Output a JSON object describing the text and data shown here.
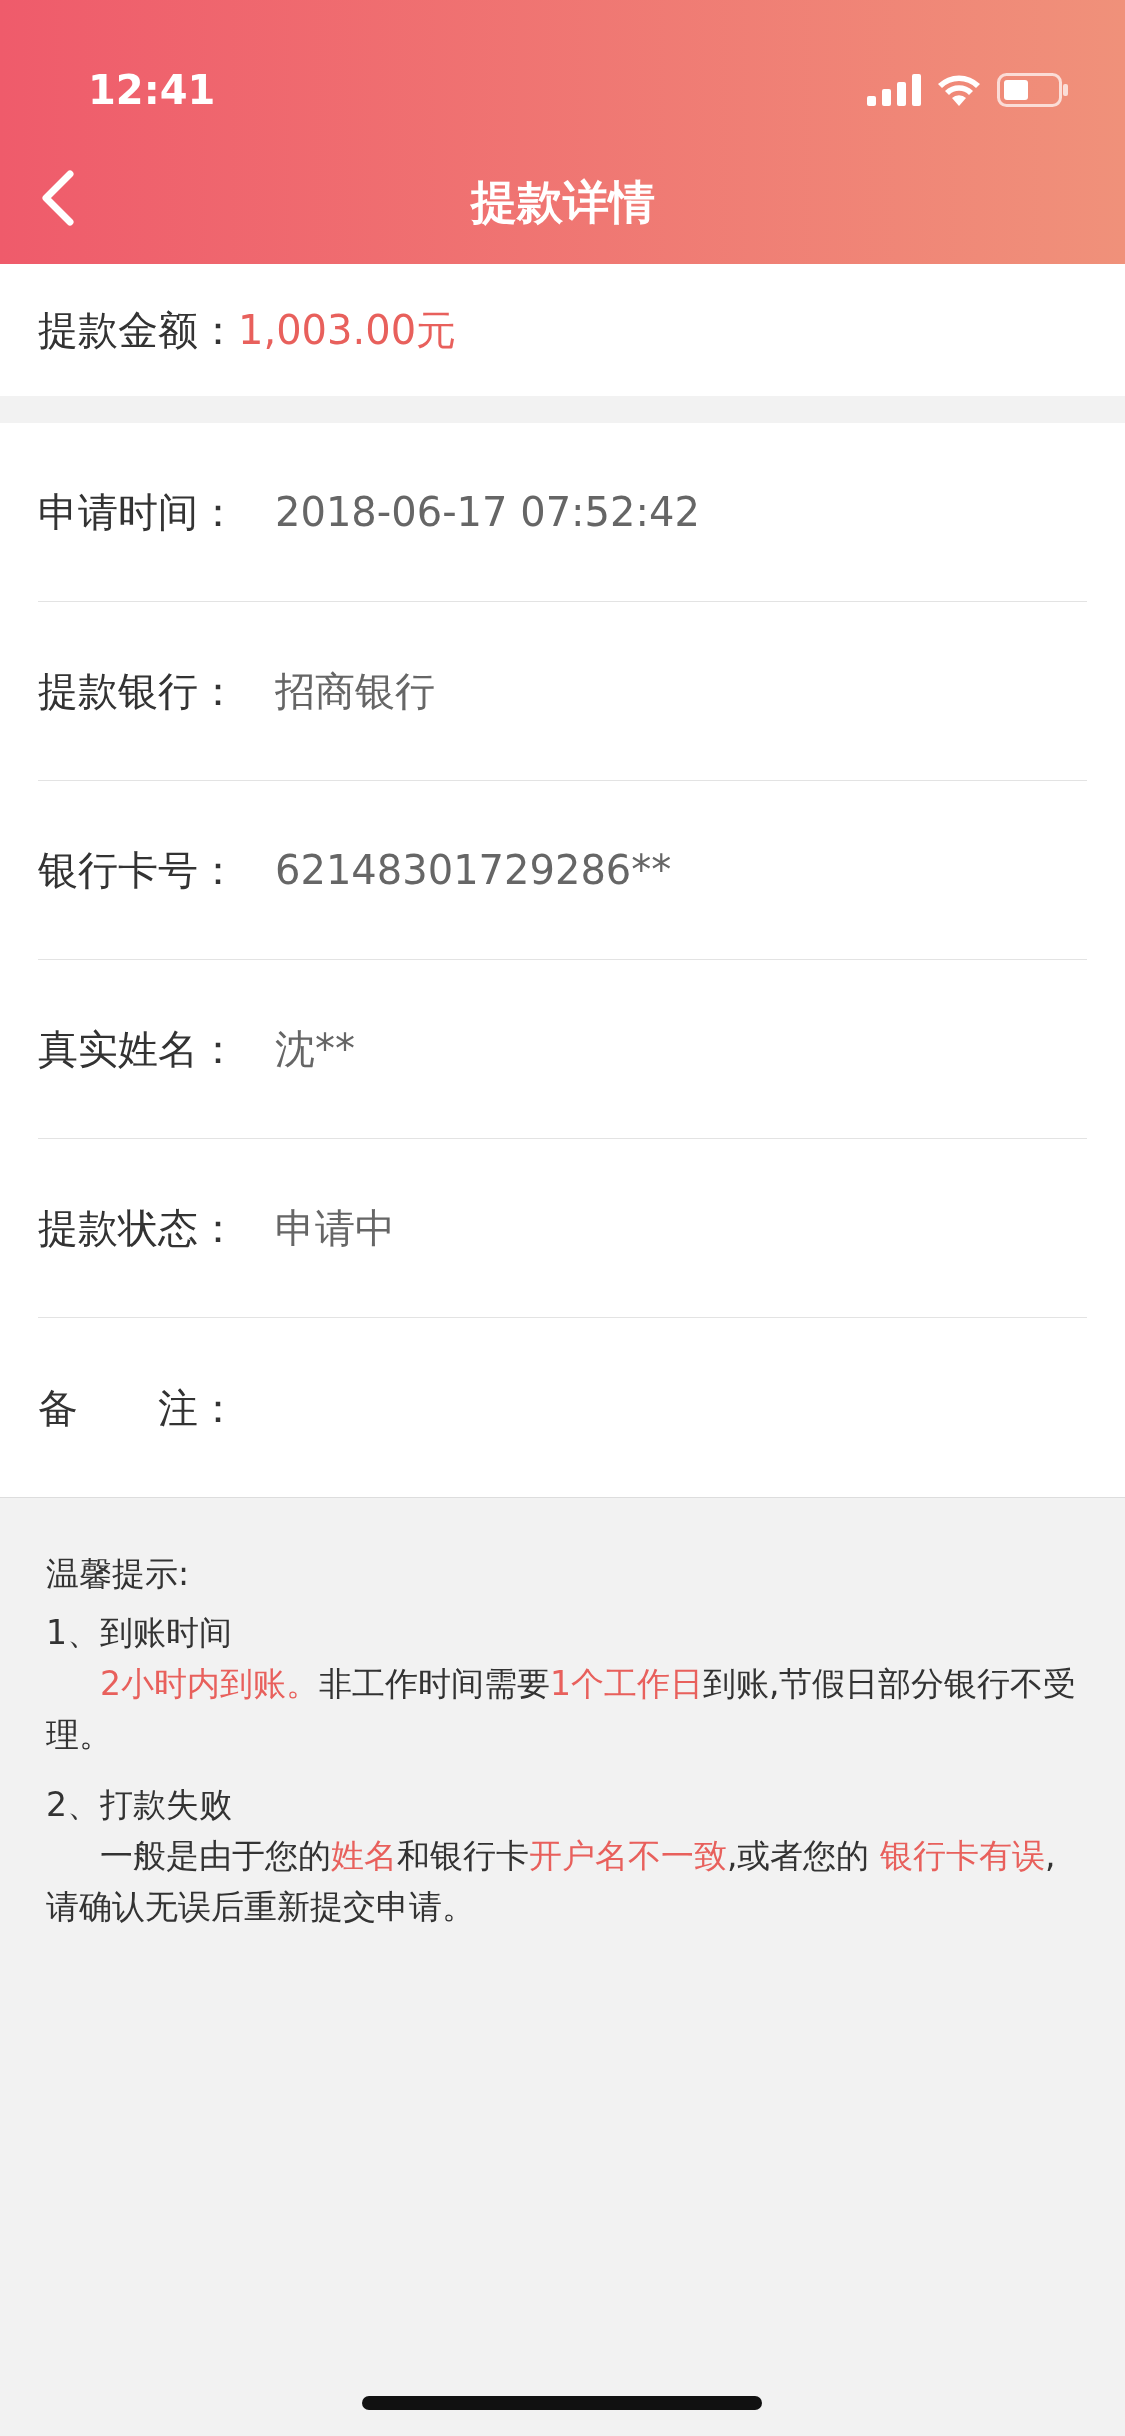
{
  "status_bar": {
    "time": "12:41"
  },
  "nav": {
    "title": "提款详情"
  },
  "amount": {
    "label": "提款金额：",
    "value": "1,003.00元"
  },
  "details": [
    {
      "label": "申请时间：",
      "value": "2018-06-17 07:52:42"
    },
    {
      "label": "提款银行：",
      "value": "招商银行"
    },
    {
      "label": "银行卡号：",
      "value": "62148301729286**"
    },
    {
      "label": "真实姓名：",
      "value": "沈**"
    },
    {
      "label": "提款状态：",
      "value": "申请中"
    },
    {
      "label": "备　　注："
    }
  ],
  "tips": {
    "title": "温馨提示:",
    "items": [
      {
        "heading": "1、到账时间",
        "parts": [
          {
            "text": "2小时内到账。",
            "highlight": true
          },
          {
            "text": "非工作时间需要",
            "highlight": false
          },
          {
            "text": "1个工作日",
            "highlight": true
          },
          {
            "text": "到账,节假日部分银行不受理。",
            "highlight": false
          }
        ]
      },
      {
        "heading": "2、打款失败",
        "parts": [
          {
            "text": "一般是由于您的",
            "highlight": false
          },
          {
            "text": "姓名",
            "highlight": true
          },
          {
            "text": "和银行卡",
            "highlight": false
          },
          {
            "text": "开户名不一致",
            "highlight": true
          },
          {
            "text": ",或者您的 ",
            "highlight": false
          },
          {
            "text": "银行卡有误",
            "highlight": true
          },
          {
            "text": ",请确认无误后重新提交申请。",
            "highlight": false
          }
        ]
      }
    ]
  }
}
